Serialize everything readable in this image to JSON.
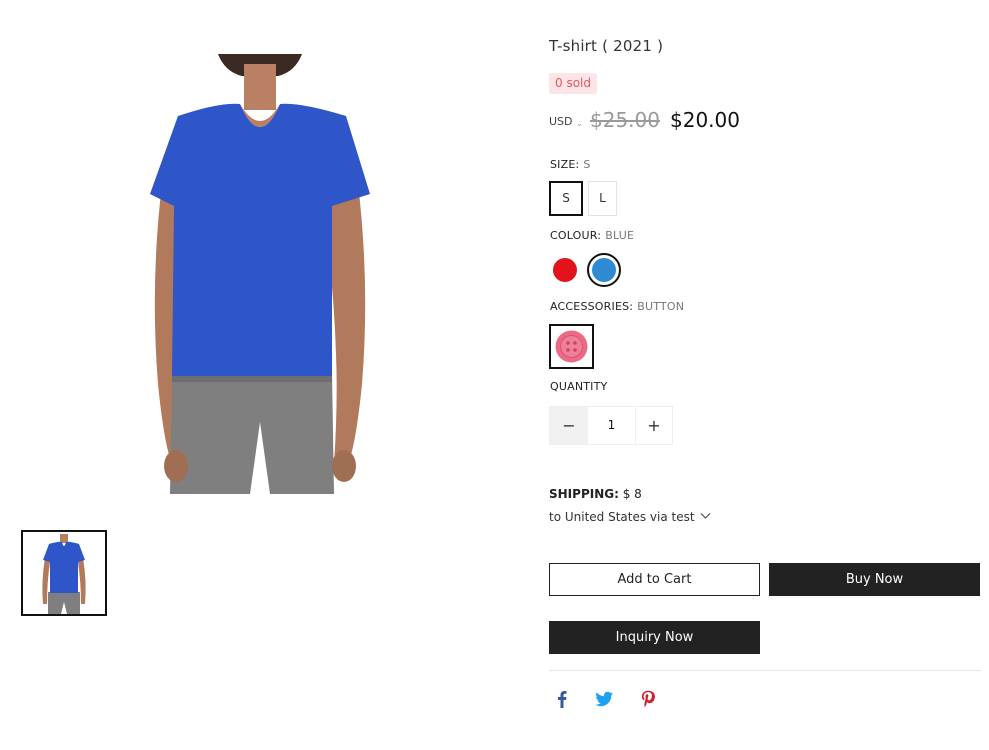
{
  "product": {
    "title": "T-shirt ( 2021 )",
    "sold_badge": "0 sold",
    "currency": "USD",
    "compare_price": "$25.00",
    "sale_price": "$20.00"
  },
  "options": {
    "size": {
      "label": "SIZE:",
      "selected": "S",
      "values": [
        "S",
        "L"
      ]
    },
    "colour": {
      "label": "COLOUR:",
      "selected": "BLUE",
      "swatches": [
        {
          "name": "red",
          "color": "#e2131a"
        },
        {
          "name": "blue",
          "color": "#2f8ad2"
        }
      ]
    },
    "accessories": {
      "label": "ACCESSORIES:",
      "selected": "BUTTON"
    }
  },
  "quantity": {
    "label": "QUANTITY",
    "value": "1",
    "minus": "−",
    "plus": "+"
  },
  "shipping": {
    "label": "SHIPPING:",
    "cost": "$ 8",
    "destination": "to United States via test"
  },
  "actions": {
    "add_to_cart": "Add to Cart",
    "buy_now": "Buy Now",
    "inquiry_now": "Inquiry Now"
  },
  "social": {
    "icons": [
      "facebook-icon",
      "twitter-icon",
      "pinterest-icon"
    ]
  },
  "colors": {
    "shirt_blue": "#2f56c9",
    "pants_gray": "#7f7f80",
    "sold_bg": "#fde4e6",
    "sold_text": "#e3585f",
    "facebook": "#3b5998",
    "twitter": "#1da1f2",
    "pinterest": "#cb2027",
    "button_dark": "#222222"
  }
}
